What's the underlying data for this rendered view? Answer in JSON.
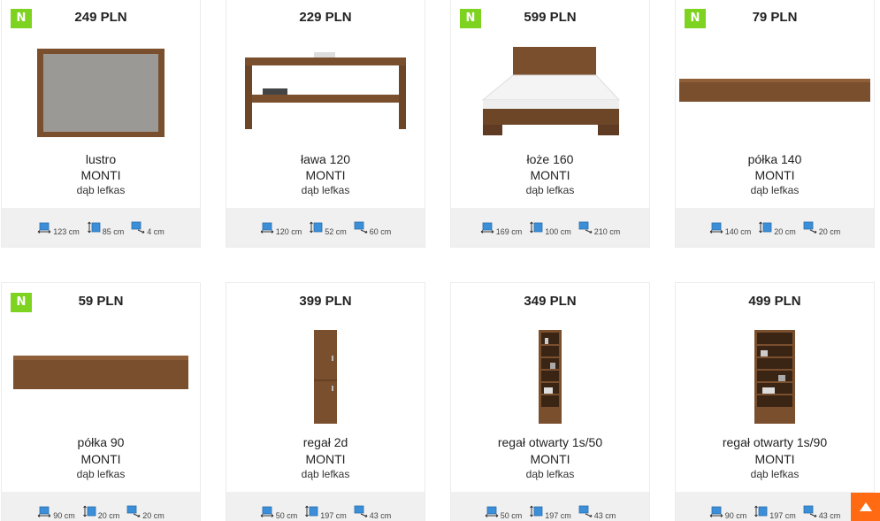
{
  "colors": {
    "new_badge": "#7ed321",
    "scroll_top": "#ff6a13",
    "dims_bar": "#f0f0f0",
    "icon_blue": "#3b8fd9"
  },
  "icons": {
    "width": "width-icon",
    "height": "height-icon",
    "depth": "depth-icon",
    "scroll_top": "arrow-up-icon"
  },
  "products": [
    {
      "new": "N",
      "price": "249 PLN",
      "name": "lustro",
      "line": "MONTI",
      "finish": "dąb lefkas",
      "width": "123 cm",
      "height": "85 cm",
      "depth": "4 cm"
    },
    {
      "new": "",
      "price": "229 PLN",
      "name": "ława 120",
      "line": "MONTI",
      "finish": "dąb lefkas",
      "width": "120 cm",
      "height": "52 cm",
      "depth": "60 cm"
    },
    {
      "new": "N",
      "price": "599 PLN",
      "name": "łoże 160",
      "line": "MONTI",
      "finish": "dąb lefkas",
      "width": "169 cm",
      "height": "100 cm",
      "depth": "210 cm"
    },
    {
      "new": "N",
      "price": "79 PLN",
      "name": "półka 140",
      "line": "MONTI",
      "finish": "dąb lefkas",
      "width": "140 cm",
      "height": "20 cm",
      "depth": "20 cm"
    },
    {
      "new": "N",
      "price": "59 PLN",
      "name": "półka 90",
      "line": "MONTI",
      "finish": "dąb lefkas",
      "width": "90 cm",
      "height": "20 cm",
      "depth": "20 cm"
    },
    {
      "new": "",
      "price": "399 PLN",
      "name": "regał 2d",
      "line": "MONTI",
      "finish": "dąb lefkas",
      "width": "50 cm",
      "height": "197 cm",
      "depth": "43 cm"
    },
    {
      "new": "",
      "price": "349 PLN",
      "name": "regał otwarty 1s/50",
      "line": "MONTI",
      "finish": "dąb lefkas",
      "width": "50 cm",
      "height": "197 cm",
      "depth": "43 cm"
    },
    {
      "new": "",
      "price": "499 PLN",
      "name": "regał otwarty 1s/90",
      "line": "MONTI",
      "finish": "dąb lefkas",
      "width": "90 cm",
      "height": "197 cm",
      "depth": "43 cm"
    }
  ]
}
